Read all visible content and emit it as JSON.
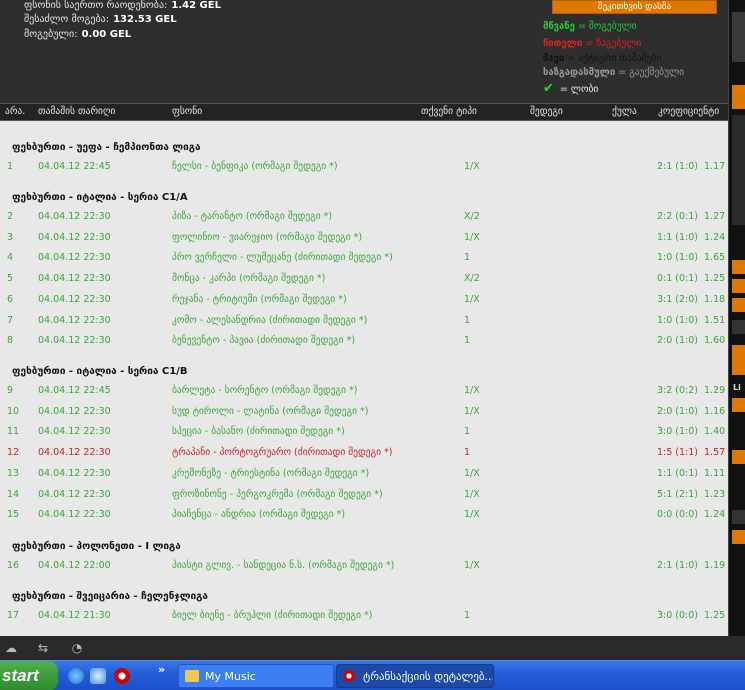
{
  "summary": {
    "total_odds_label": "ფსონის საერთო რაოდენობა:",
    "total_odds_value": "1.42 GEL",
    "possible_win_label": "შესაძლო მოგება:",
    "possible_win_value": "132.53 GEL",
    "won_label": "მოგებული:",
    "won_value": "0.00 GEL"
  },
  "header_button": "შეკითხვის დასმა",
  "legend": {
    "green_word": "მწვანე",
    "green_desc": "= მოგებული",
    "red_word": "წითელი",
    "red_desc": "= წაგებული",
    "black_word": "შავი",
    "black_desc": "= აქტიური თამაშები",
    "gray_word": "ხაზგადასმული",
    "gray_desc": "= გაუქმებული",
    "check_desc": "= ლობი",
    "colors": {
      "green": "#22cc33",
      "red": "#dd2222",
      "black": "#111111",
      "gray": "#999999"
    }
  },
  "columns": [
    "არა.",
    "თამაშის თარიღი",
    "ფსონი",
    "თქვენი ტიპი",
    "შედეგი",
    "ქულა",
    "კოეფიციენტი"
  ],
  "groups": [
    {
      "title": "ფეხბურთი - უეფა - ჩემპიონთა ლიგა",
      "rows": [
        {
          "num": "1",
          "date": "04.04.12 22:45",
          "match": "ჩელსი - ბენფიკა (ორმაგი შედეგი *)",
          "type": "1/X",
          "score": "2:1 (1:0)",
          "coef": "1.17",
          "status": "won"
        }
      ]
    },
    {
      "title": "ფეხბურთი - იტალია - სერია C1/A",
      "rows": [
        {
          "num": "2",
          "date": "04.04.12 22:30",
          "match": "პიზა - ტარანტო (ორმაგი შედეგი *)",
          "type": "X/2",
          "score": "2:2 (0:1)",
          "coef": "1.27",
          "status": "won"
        },
        {
          "num": "3",
          "date": "04.04.12 22:30",
          "match": "ფოლინიო - ვიარეჯიო (ორმაგი შედეგი *)",
          "type": "1/X",
          "score": "1:1 (1:0)",
          "coef": "1.24",
          "status": "won"
        },
        {
          "num": "4",
          "date": "04.04.12 22:30",
          "match": "პრო ვერჩელი - ლუმეცანე (ძირითადი შედეგი *)",
          "type": "1",
          "score": "1:0 (1:0)",
          "coef": "1.65",
          "status": "won"
        },
        {
          "num": "5",
          "date": "04.04.12 22:30",
          "match": "მონცა - კარპი (ორმაგი შედეგი *)",
          "type": "X/2",
          "score": "0:1 (0:1)",
          "coef": "1.25",
          "status": "won"
        },
        {
          "num": "6",
          "date": "04.04.12 22:30",
          "match": "რეჯანა - ტრიტიუმი (ორმაგი შედეგი *)",
          "type": "1/X",
          "score": "3:1 (2:0)",
          "coef": "1.18",
          "status": "won"
        },
        {
          "num": "7",
          "date": "04.04.12 22:30",
          "match": "კომო - ალესანდრია (ძირითადი შედეგი *)",
          "type": "1",
          "score": "1:0 (1:0)",
          "coef": "1.51",
          "status": "won"
        },
        {
          "num": "8",
          "date": "04.04.12 22:30",
          "match": "ბენევენტო - პავია (ძირითადი შედეგი *)",
          "type": "1",
          "score": "2:0 (1:0)",
          "coef": "1.60",
          "status": "won"
        }
      ]
    },
    {
      "title": "ფეხბურთი - იტალია - სერია C1/B",
      "rows": [
        {
          "num": "9",
          "date": "04.04.12 22:45",
          "match": "ბარლეტა - სორენტო (ორმაგი შედეგი *)",
          "type": "1/X",
          "score": "3:2 (0:2)",
          "coef": "1.29",
          "status": "won"
        },
        {
          "num": "10",
          "date": "04.04.12 22:30",
          "match": "სუდ ტიროლი - ლატინა (ორმაგი შედეგი *)",
          "type": "1/X",
          "score": "2:0 (1:0)",
          "coef": "1.16",
          "status": "won"
        },
        {
          "num": "11",
          "date": "04.04.12 22:30",
          "match": "სპეცია - ბასანო (ძირითადი შედეგი *)",
          "type": "1",
          "score": "3:0 (1:0)",
          "coef": "1.40",
          "status": "won"
        },
        {
          "num": "12",
          "date": "04.04.12 22:30",
          "match": "ტრაპანი - პორტოგრუარო (ძირითადი შედეგი *)",
          "type": "1",
          "score": "1:5 (1:1)",
          "coef": "1.57",
          "status": "lost"
        },
        {
          "num": "13",
          "date": "04.04.12 22:30",
          "match": "კრემონეზე - ტრიესტინა (ორმაგი შედეგი *)",
          "type": "1/X",
          "score": "1:1 (0:1)",
          "coef": "1.11",
          "status": "won"
        },
        {
          "num": "14",
          "date": "04.04.12 22:30",
          "match": "ფროზინონე - პერგოკრემა (ორმაგი შედეგი *)",
          "type": "1/X",
          "score": "5:1 (2:1)",
          "coef": "1.23",
          "status": "won"
        },
        {
          "num": "15",
          "date": "04.04.12 22:30",
          "match": "პიაჩენცა - ანდრია (ორმაგი შედეგი *)",
          "type": "1/X",
          "score": "0:0 (0:0)",
          "coef": "1.24",
          "status": "won"
        }
      ]
    },
    {
      "title": "ფეხბურთი - პოლონეთი - I ლიგა",
      "rows": [
        {
          "num": "16",
          "date": "04.04.12 22:00",
          "match": "პიასტი გლივ. - სანდეცია ნ.ს. (ორმაგი შედეგი *)",
          "type": "1/X",
          "score": "2:1 (1:0)",
          "coef": "1.19",
          "status": "won"
        }
      ]
    },
    {
      "title": "ფეხბურთი - შვეიცარია - ჩელენჯლიგა",
      "rows": [
        {
          "num": "17",
          "date": "04.04.12 21:30",
          "match": "ბიელ ბიენე - ბრუჰლი (ძირითადი შედეგი *)",
          "type": "1",
          "score": "3:0 (0:0)",
          "coef": "1.25",
          "status": "won"
        }
      ]
    }
  ],
  "right_panel": {
    "text1": "Li"
  },
  "taskbar": {
    "start": "start",
    "chevron": "»",
    "btn1": "My Music",
    "btn2": "ტრანსაქციის დეტალებ..."
  }
}
